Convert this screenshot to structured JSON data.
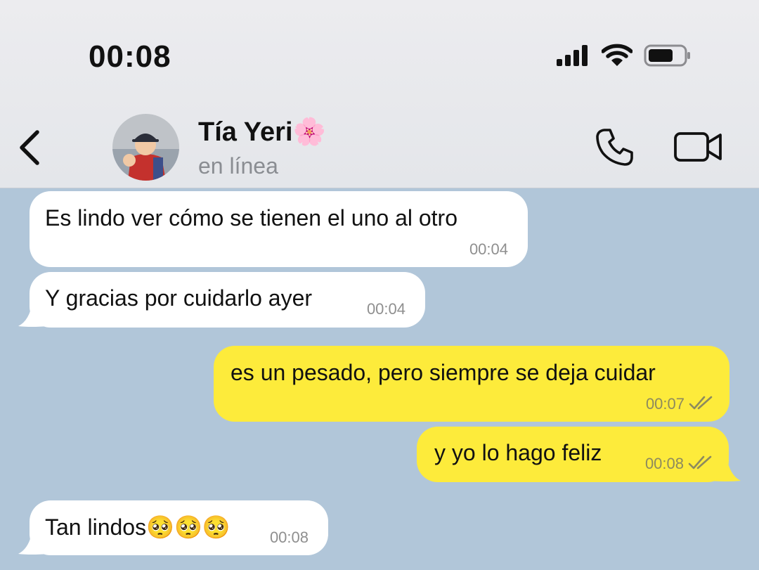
{
  "status_bar": {
    "time": "00:08",
    "icons": [
      "signal-icon",
      "wifi-icon",
      "battery-icon"
    ]
  },
  "header": {
    "back_icon": "chevron-left-icon",
    "contact_name": "Tía Yeri🌸",
    "contact_status": "en línea",
    "call_icon": "phone-icon",
    "video_icon": "video-camera-icon"
  },
  "colors": {
    "chat_background": "#b1c6d9",
    "incoming_bubble": "#ffffff",
    "outgoing_bubble": "#fdeb3b",
    "header_background": "#e8e9ec"
  },
  "messages": [
    {
      "direction": "incoming",
      "text": "Es lindo ver cómo se tienen el uno al otro",
      "time": "00:04"
    },
    {
      "direction": "incoming",
      "text": "Y gracias por cuidarlo ayer",
      "time": "00:04"
    },
    {
      "direction": "outgoing",
      "text": "es un pesado, pero siempre se deja cuidar",
      "time": "00:07",
      "status": "read"
    },
    {
      "direction": "outgoing",
      "text": "y yo lo hago feliz",
      "time": "00:08",
      "status": "read"
    },
    {
      "direction": "incoming",
      "text": "Tan lindos🥺🥺🥺",
      "time": "00:08"
    }
  ]
}
